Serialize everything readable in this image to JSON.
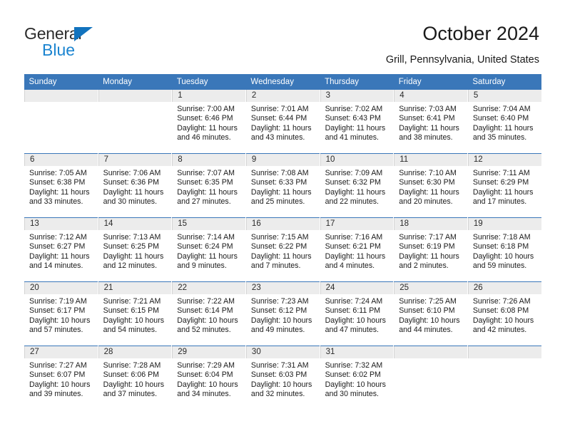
{
  "brand": {
    "name_top": "General",
    "name_bottom": "Blue",
    "accent_color": "#1b84d0",
    "triangle_color": "#1273be"
  },
  "header": {
    "title": "October 2024",
    "subtitle": "Grill, Pennsylvania, United States"
  },
  "theme": {
    "header_row_color": "#3a77b9",
    "daystrip_color": "#ececec",
    "text_color": "#1a1a1a"
  },
  "weekday_headers": [
    "Sunday",
    "Monday",
    "Tuesday",
    "Wednesday",
    "Thursday",
    "Friday",
    "Saturday"
  ],
  "weeks": [
    [
      {
        "day": "",
        "sunrise": "",
        "sunset": "",
        "daylight_line1": "",
        "daylight_line2": ""
      },
      {
        "day": "",
        "sunrise": "",
        "sunset": "",
        "daylight_line1": "",
        "daylight_line2": ""
      },
      {
        "day": "1",
        "sunrise": "Sunrise: 7:00 AM",
        "sunset": "Sunset: 6:46 PM",
        "daylight_line1": "Daylight: 11 hours",
        "daylight_line2": "and 46 minutes."
      },
      {
        "day": "2",
        "sunrise": "Sunrise: 7:01 AM",
        "sunset": "Sunset: 6:44 PM",
        "daylight_line1": "Daylight: 11 hours",
        "daylight_line2": "and 43 minutes."
      },
      {
        "day": "3",
        "sunrise": "Sunrise: 7:02 AM",
        "sunset": "Sunset: 6:43 PM",
        "daylight_line1": "Daylight: 11 hours",
        "daylight_line2": "and 41 minutes."
      },
      {
        "day": "4",
        "sunrise": "Sunrise: 7:03 AM",
        "sunset": "Sunset: 6:41 PM",
        "daylight_line1": "Daylight: 11 hours",
        "daylight_line2": "and 38 minutes."
      },
      {
        "day": "5",
        "sunrise": "Sunrise: 7:04 AM",
        "sunset": "Sunset: 6:40 PM",
        "daylight_line1": "Daylight: 11 hours",
        "daylight_line2": "and 35 minutes."
      }
    ],
    [
      {
        "day": "6",
        "sunrise": "Sunrise: 7:05 AM",
        "sunset": "Sunset: 6:38 PM",
        "daylight_line1": "Daylight: 11 hours",
        "daylight_line2": "and 33 minutes."
      },
      {
        "day": "7",
        "sunrise": "Sunrise: 7:06 AM",
        "sunset": "Sunset: 6:36 PM",
        "daylight_line1": "Daylight: 11 hours",
        "daylight_line2": "and 30 minutes."
      },
      {
        "day": "8",
        "sunrise": "Sunrise: 7:07 AM",
        "sunset": "Sunset: 6:35 PM",
        "daylight_line1": "Daylight: 11 hours",
        "daylight_line2": "and 27 minutes."
      },
      {
        "day": "9",
        "sunrise": "Sunrise: 7:08 AM",
        "sunset": "Sunset: 6:33 PM",
        "daylight_line1": "Daylight: 11 hours",
        "daylight_line2": "and 25 minutes."
      },
      {
        "day": "10",
        "sunrise": "Sunrise: 7:09 AM",
        "sunset": "Sunset: 6:32 PM",
        "daylight_line1": "Daylight: 11 hours",
        "daylight_line2": "and 22 minutes."
      },
      {
        "day": "11",
        "sunrise": "Sunrise: 7:10 AM",
        "sunset": "Sunset: 6:30 PM",
        "daylight_line1": "Daylight: 11 hours",
        "daylight_line2": "and 20 minutes."
      },
      {
        "day": "12",
        "sunrise": "Sunrise: 7:11 AM",
        "sunset": "Sunset: 6:29 PM",
        "daylight_line1": "Daylight: 11 hours",
        "daylight_line2": "and 17 minutes."
      }
    ],
    [
      {
        "day": "13",
        "sunrise": "Sunrise: 7:12 AM",
        "sunset": "Sunset: 6:27 PM",
        "daylight_line1": "Daylight: 11 hours",
        "daylight_line2": "and 14 minutes."
      },
      {
        "day": "14",
        "sunrise": "Sunrise: 7:13 AM",
        "sunset": "Sunset: 6:25 PM",
        "daylight_line1": "Daylight: 11 hours",
        "daylight_line2": "and 12 minutes."
      },
      {
        "day": "15",
        "sunrise": "Sunrise: 7:14 AM",
        "sunset": "Sunset: 6:24 PM",
        "daylight_line1": "Daylight: 11 hours",
        "daylight_line2": "and 9 minutes."
      },
      {
        "day": "16",
        "sunrise": "Sunrise: 7:15 AM",
        "sunset": "Sunset: 6:22 PM",
        "daylight_line1": "Daylight: 11 hours",
        "daylight_line2": "and 7 minutes."
      },
      {
        "day": "17",
        "sunrise": "Sunrise: 7:16 AM",
        "sunset": "Sunset: 6:21 PM",
        "daylight_line1": "Daylight: 11 hours",
        "daylight_line2": "and 4 minutes."
      },
      {
        "day": "18",
        "sunrise": "Sunrise: 7:17 AM",
        "sunset": "Sunset: 6:19 PM",
        "daylight_line1": "Daylight: 11 hours",
        "daylight_line2": "and 2 minutes."
      },
      {
        "day": "19",
        "sunrise": "Sunrise: 7:18 AM",
        "sunset": "Sunset: 6:18 PM",
        "daylight_line1": "Daylight: 10 hours",
        "daylight_line2": "and 59 minutes."
      }
    ],
    [
      {
        "day": "20",
        "sunrise": "Sunrise: 7:19 AM",
        "sunset": "Sunset: 6:17 PM",
        "daylight_line1": "Daylight: 10 hours",
        "daylight_line2": "and 57 minutes."
      },
      {
        "day": "21",
        "sunrise": "Sunrise: 7:21 AM",
        "sunset": "Sunset: 6:15 PM",
        "daylight_line1": "Daylight: 10 hours",
        "daylight_line2": "and 54 minutes."
      },
      {
        "day": "22",
        "sunrise": "Sunrise: 7:22 AM",
        "sunset": "Sunset: 6:14 PM",
        "daylight_line1": "Daylight: 10 hours",
        "daylight_line2": "and 52 minutes."
      },
      {
        "day": "23",
        "sunrise": "Sunrise: 7:23 AM",
        "sunset": "Sunset: 6:12 PM",
        "daylight_line1": "Daylight: 10 hours",
        "daylight_line2": "and 49 minutes."
      },
      {
        "day": "24",
        "sunrise": "Sunrise: 7:24 AM",
        "sunset": "Sunset: 6:11 PM",
        "daylight_line1": "Daylight: 10 hours",
        "daylight_line2": "and 47 minutes."
      },
      {
        "day": "25",
        "sunrise": "Sunrise: 7:25 AM",
        "sunset": "Sunset: 6:10 PM",
        "daylight_line1": "Daylight: 10 hours",
        "daylight_line2": "and 44 minutes."
      },
      {
        "day": "26",
        "sunrise": "Sunrise: 7:26 AM",
        "sunset": "Sunset: 6:08 PM",
        "daylight_line1": "Daylight: 10 hours",
        "daylight_line2": "and 42 minutes."
      }
    ],
    [
      {
        "day": "27",
        "sunrise": "Sunrise: 7:27 AM",
        "sunset": "Sunset: 6:07 PM",
        "daylight_line1": "Daylight: 10 hours",
        "daylight_line2": "and 39 minutes."
      },
      {
        "day": "28",
        "sunrise": "Sunrise: 7:28 AM",
        "sunset": "Sunset: 6:06 PM",
        "daylight_line1": "Daylight: 10 hours",
        "daylight_line2": "and 37 minutes."
      },
      {
        "day": "29",
        "sunrise": "Sunrise: 7:29 AM",
        "sunset": "Sunset: 6:04 PM",
        "daylight_line1": "Daylight: 10 hours",
        "daylight_line2": "and 34 minutes."
      },
      {
        "day": "30",
        "sunrise": "Sunrise: 7:31 AM",
        "sunset": "Sunset: 6:03 PM",
        "daylight_line1": "Daylight: 10 hours",
        "daylight_line2": "and 32 minutes."
      },
      {
        "day": "31",
        "sunrise": "Sunrise: 7:32 AM",
        "sunset": "Sunset: 6:02 PM",
        "daylight_line1": "Daylight: 10 hours",
        "daylight_line2": "and 30 minutes."
      },
      {
        "day": "",
        "sunrise": "",
        "sunset": "",
        "daylight_line1": "",
        "daylight_line2": ""
      },
      {
        "day": "",
        "sunrise": "",
        "sunset": "",
        "daylight_line1": "",
        "daylight_line2": ""
      }
    ]
  ]
}
